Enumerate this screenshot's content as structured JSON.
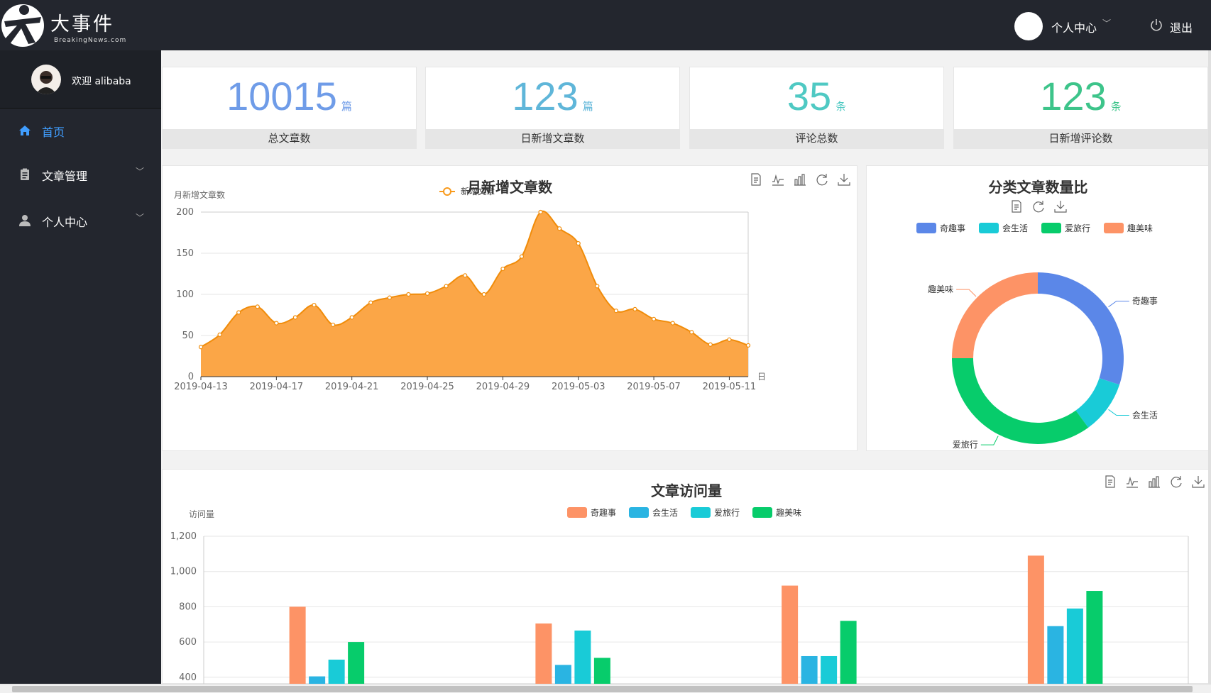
{
  "header": {
    "logo_title": "大事件",
    "logo_subtitle": "BreakingNews.com",
    "user_menu_label": "个人中心",
    "logout_label": "退出"
  },
  "sidebar": {
    "welcome": "欢迎 alibaba",
    "items": [
      {
        "label": "首页",
        "icon": "home-icon",
        "active": true
      },
      {
        "label": "文章管理",
        "icon": "clipboard-icon",
        "active": false
      },
      {
        "label": "个人中心",
        "icon": "user-icon",
        "active": false
      }
    ]
  },
  "stats": [
    {
      "value": "10015",
      "unit": "篇",
      "label": "总文章数",
      "color": "#6f9ce8"
    },
    {
      "value": "123",
      "unit": "篇",
      "label": "日新增文章数",
      "color": "#5fb6d9"
    },
    {
      "value": "35",
      "unit": "条",
      "label": "评论总数",
      "color": "#4fc9c3"
    },
    {
      "value": "123",
      "unit": "条",
      "label": "日新增评论数",
      "color": "#3dc48a"
    }
  ],
  "chart_data": [
    {
      "type": "area",
      "title": "月新增文章数",
      "ylabel": "月新增文章数",
      "xlabel": "日",
      "legend": [
        "新增文章"
      ],
      "ylim": [
        0,
        200
      ],
      "yticks": [
        0,
        50,
        100,
        150,
        200
      ],
      "xticks": [
        "2019-04-13",
        "2019-04-17",
        "2019-04-21",
        "2019-04-25",
        "2019-04-29",
        "2019-05-03",
        "2019-05-07",
        "2019-05-11"
      ],
      "x": [
        "2019-04-13",
        "2019-04-14",
        "2019-04-15",
        "2019-04-16",
        "2019-04-17",
        "2019-04-18",
        "2019-04-19",
        "2019-04-20",
        "2019-04-21",
        "2019-04-22",
        "2019-04-23",
        "2019-04-24",
        "2019-04-25",
        "2019-04-26",
        "2019-04-27",
        "2019-04-28",
        "2019-04-29",
        "2019-04-30",
        "2019-05-01",
        "2019-05-02",
        "2019-05-03",
        "2019-05-04",
        "2019-05-05",
        "2019-05-06",
        "2019-05-07",
        "2019-05-08",
        "2019-05-09",
        "2019-05-10",
        "2019-05-11",
        "2019-05-12"
      ],
      "series": [
        {
          "name": "新增文章",
          "color": "#f89a1c",
          "values": [
            36,
            51,
            78,
            85,
            65,
            72,
            87,
            63,
            72,
            90,
            96,
            100,
            101,
            110,
            123,
            100,
            131,
            146,
            200,
            180,
            162,
            110,
            80,
            82,
            70,
            65,
            54,
            39,
            45,
            38
          ]
        }
      ]
    },
    {
      "type": "pie",
      "title": "分类文章数量比",
      "legend": [
        "奇趣事",
        "会生活",
        "爱旅行",
        "趣美味"
      ],
      "colors": [
        "#5b87e8",
        "#19cbd7",
        "#07cc6b",
        "#fd9366"
      ],
      "values": [
        30,
        10,
        35,
        25
      ]
    },
    {
      "type": "bar",
      "title": "文章访问量",
      "ylabel": "访问量",
      "ylim": [
        400,
        1200
      ],
      "yticks": [
        "1,200",
        "1,000",
        "800",
        "600",
        "400"
      ],
      "legend": [
        "奇趣事",
        "会生活",
        "爱旅行",
        "趣美味"
      ],
      "colors": [
        "#fd9366",
        "#2ab4e2",
        "#19cbd7",
        "#07cc6b"
      ],
      "series": [
        {
          "name": "奇趣事",
          "values": [
            800,
            705,
            920,
            1090
          ]
        },
        {
          "name": "会生活",
          "values": [
            405,
            470,
            520,
            690
          ]
        },
        {
          "name": "爱旅行",
          "values": [
            500,
            665,
            520,
            790
          ]
        },
        {
          "name": "趣美味",
          "values": [
            600,
            510,
            720,
            890
          ]
        }
      ]
    }
  ]
}
